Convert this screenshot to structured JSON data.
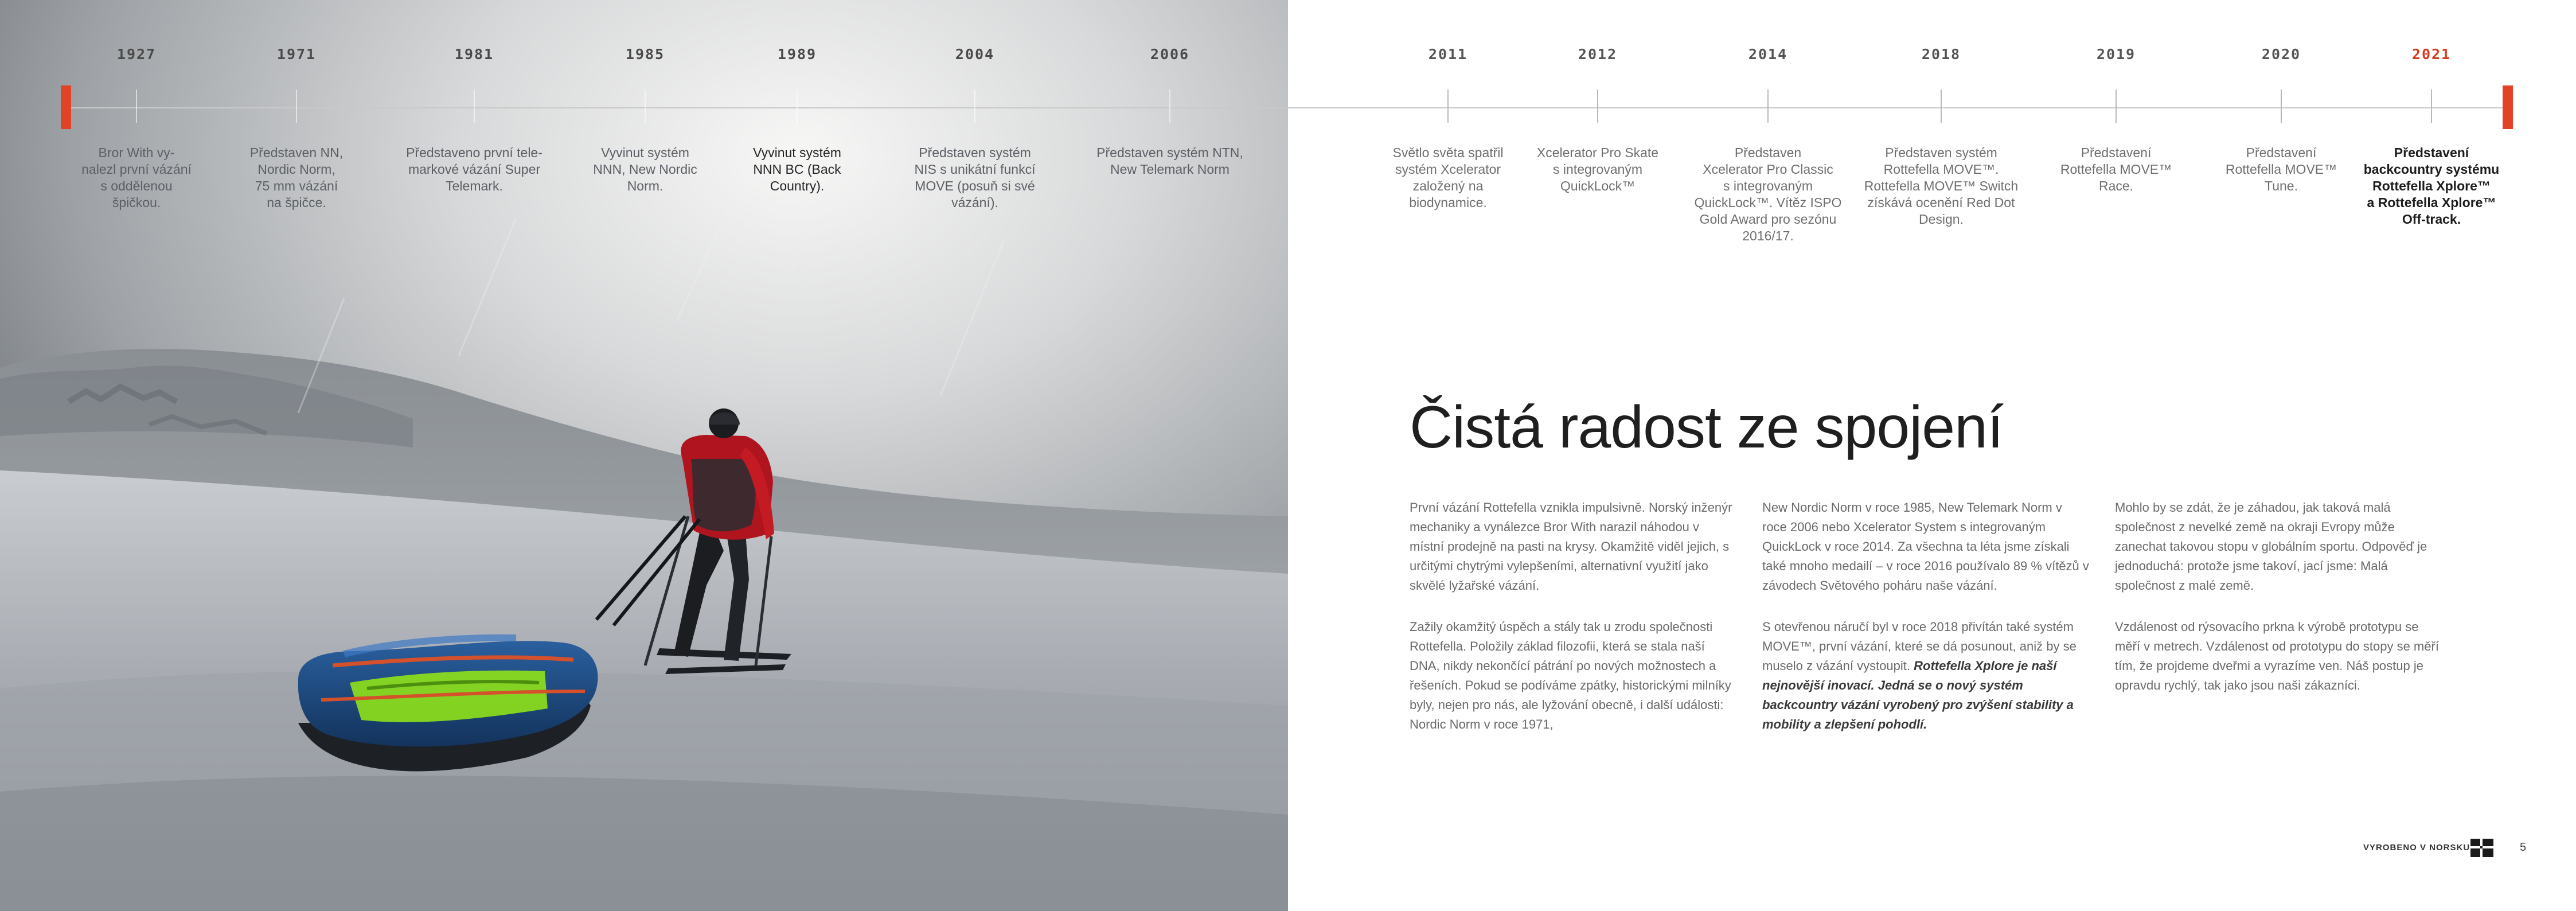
{
  "title": "Čistá radost ze spojení",
  "accent_color": "#e24226",
  "timeline": [
    {
      "year": "1927",
      "text": "Bror With vy-\nnalezl první vázání\ns oddělenou\nšpičkou."
    },
    {
      "year": "1971",
      "text": "Představen NN,\nNordic Norm,\n75 mm vázání\nna špičce."
    },
    {
      "year": "1981",
      "text": "Představeno první tele-\nmarkové vázání Super\nTelemark."
    },
    {
      "year": "1985",
      "text": "Vyvinut systém\nNNN, New Nordic\nNorm."
    },
    {
      "year": "1989",
      "text": "Vyvinut systém\nNNN BC (Back\nCountry)."
    },
    {
      "year": "2004",
      "text": "Představen systém\nNIS s unikátní funkcí\nMOVE (posuň si své\nvázání)."
    },
    {
      "year": "2006",
      "text": "Představen systém NTN,\nNew Telemark Norm"
    },
    {
      "year": "2011",
      "text": "Světlo světa spatřil\nsystém Xcelerator\nzaložený na\nbiodynamice."
    },
    {
      "year": "2012",
      "text": "Xcelerator Pro Skate\ns integrovaným\nQuickLock™"
    },
    {
      "year": "2014",
      "text": "Představen\nXcelerator Pro Classic\ns integrovaným\nQuickLock™. Vítěz ISPO\nGold Award pro sezónu\n2016/17."
    },
    {
      "year": "2018",
      "text": "Představen systém\nRottefella MOVE™.\nRottefella MOVE™ Switch\nzískává ocenění Red Dot\nDesign."
    },
    {
      "year": "2019",
      "text": "Představení\nRottefella MOVE™\nRace."
    },
    {
      "year": "2020",
      "text": "Představení\nRottefella MOVE™\nTune."
    },
    {
      "year": "2021",
      "text": "Představení\nbackcountry systému\nRottefella Xplore™\na Rottefella Xplore™\nOff-track."
    }
  ],
  "columns": [
    {
      "paragraphs": [
        "První vázání Rottefella vznikla impulsivně. Norský inženýr mechaniky a vynálezce Bror With narazil náhodou v místní prodejně na pasti na krysy. Okamžitě viděl jejich, s určitými chytrými vylepšeními, alternativní využití jako skvělé lyžařské vázání.",
        "Zažily okamžitý úspěch a stály tak u zrodu společnosti Rottefella. Položily základ filozofii, která se stala naší DNA, nikdy nekončící pátrání po nových možnostech a řešeních. Pokud se podíváme zpátky, historickými milníky byly, nejen pro nás, ale lyžování obecně, i další události: Nordic Norm v roce 1971,"
      ]
    },
    {
      "paragraphs": [
        "New Nordic Norm v roce 1985, New Telemark Norm v roce 2006 nebo Xcelerator System s integrovaným QuickLock v roce 2014. Za všechna ta léta jsme získali také mnoho medailí – v roce 2016 používalo 89 % vítězů v závodech Světového poháru naše vázání."
      ],
      "paragraph2_lead": "S otevřenou náručí byl v roce 2018 přivítán také systém MOVE™, první vázání, které se dá posunout, aniž by se muselo z vázání vystoupit. ",
      "paragraph2_emphasis": "Rottefella Xplore  je naší nejnovější inovací. Jedná se o nový systém backcountry vázání vyrobený pro zvýšení stability a mobility a zlepšení pohodlí."
    },
    {
      "paragraphs": [
        "Mohlo by se zdát, že je záhadou, jak taková malá společnost z nevelké země na okraji Evropy může zanechat takovou stopu v globálním sportu. Odpověď je jednoduchá: protože jsme takoví, jací jsme: Malá společnost z malé země.",
        "Vzdálenost od rýsovacího prkna k výrobě prototypu se měří v metrech. Vzdálenost od prototypu do stopy se měří tím, že projdeme dveřmi a vyrazíme ven. Náš postup je opravdu rychlý, tak jako jsou naši zákazníci."
      ]
    }
  ],
  "footer": {
    "label": "VYROBENO V NORSKU",
    "page_number": "5"
  }
}
